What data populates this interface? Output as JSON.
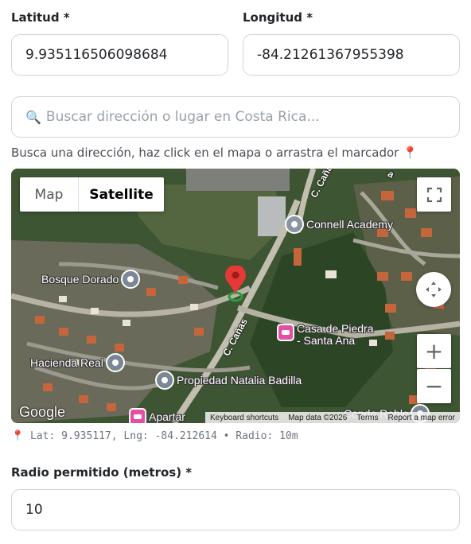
{
  "latitude": {
    "label": "Latitud *",
    "value": "9.935116506098684"
  },
  "longitude": {
    "label": "Longitud *",
    "value": "-84.21261367955398"
  },
  "search": {
    "icon": "🔍",
    "placeholder": "Buscar dirección o lugar en Costa Rica..."
  },
  "help_text": "Busca una dirección, haz click en el mapa o arrastra el marcador 📍",
  "map": {
    "type_map": "Map",
    "type_satellite": "Satellite",
    "zoom_in": "+",
    "zoom_out": "−",
    "pois": {
      "connell": "Connell Academy",
      "bosque": "Bosque Dorado",
      "casa": "Casa de Piedra\n- Santa Ana",
      "hacienda": "Hacienda Real",
      "propiedad": "Propiedad Natalia Badilla",
      "apartar": "Apartar",
      "condo": "Condo Roble"
    },
    "streets": {
      "canas1": "C. Cañas",
      "canas2": "C. Cañas",
      "top_right": "a"
    },
    "logo": "Google",
    "attribution": {
      "shortcuts": "Keyboard shortcuts",
      "data": "Map data ©2026",
      "terms": "Terms",
      "report": "Report a map error"
    }
  },
  "coordinates_text": "📍 Lat: 9.935117, Lng: -84.212614 • Radio: 10m",
  "radius": {
    "label": "Radio permitido (metros) *",
    "value": "10"
  }
}
